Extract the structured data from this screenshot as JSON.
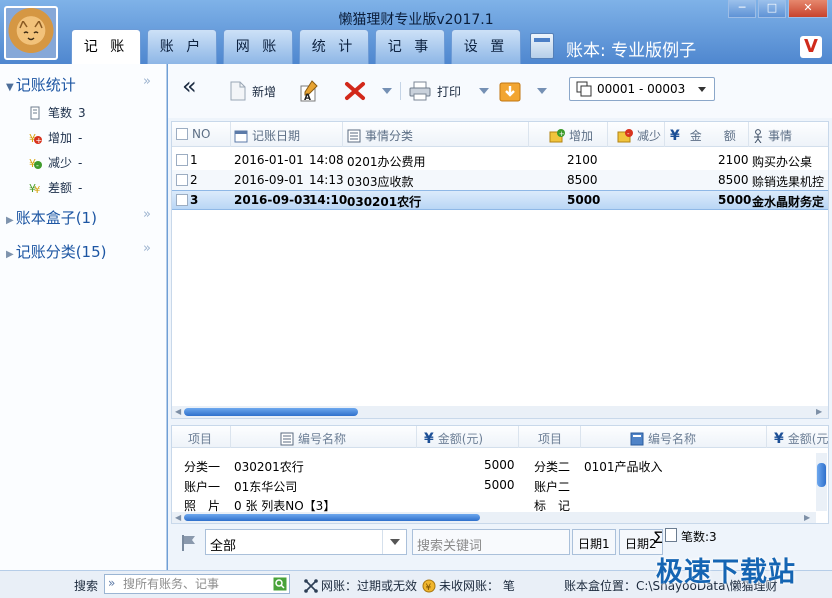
{
  "window": {
    "title": "懒猫理财专业版v2017.1",
    "controls": {
      "minimize": "─",
      "maximize": "□",
      "close": "✕"
    }
  },
  "tabs": [
    {
      "label": "记 账",
      "active": true
    },
    {
      "label": "账 户",
      "active": false
    },
    {
      "label": "网 账",
      "active": false
    },
    {
      "label": "统 计",
      "active": false
    },
    {
      "label": "记 事",
      "active": false
    },
    {
      "label": "设 置",
      "active": false
    }
  ],
  "book": {
    "label": "账本: 专业版例子",
    "logo": "V"
  },
  "sidebar": {
    "sections": [
      {
        "label": "记账统计",
        "expanded": true
      },
      {
        "label": "账本盒子(1)",
        "expanded": false
      },
      {
        "label": "记账分类(15)",
        "expanded": false
      }
    ],
    "collapse_glyph": "»",
    "stats": [
      {
        "icon": "ledger-icon",
        "label": "笔数",
        "value": "3"
      },
      {
        "icon": "increase-icon",
        "label": "增加",
        "value": "-"
      },
      {
        "icon": "decrease-icon",
        "label": "减少",
        "value": "-"
      },
      {
        "icon": "difference-icon",
        "label": "差额",
        "value": "-"
      }
    ]
  },
  "toolbar": {
    "back_glyph": "«",
    "new_label": "新增",
    "print_label": "打印",
    "range_value": "00001 - 00003"
  },
  "grid": {
    "columns": {
      "no": "NO",
      "date": "记账日期",
      "category": "事情分类",
      "increase": "增加",
      "decrease": "减少",
      "amount_a": "金",
      "amount_b": "额",
      "matter": "事情"
    },
    "rows": [
      {
        "no": "1",
        "date": "2016-01-01",
        "time": "14:08",
        "category": "0201办公费用",
        "increase": "2100",
        "amount": "2100",
        "matter": "购买办公桌",
        "selected": false
      },
      {
        "no": "2",
        "date": "2016-09-01",
        "time": "14:13",
        "category": "0303应收款",
        "increase": "8500",
        "amount": "8500",
        "matter": "赊销选果机控",
        "selected": false
      },
      {
        "no": "3",
        "date": "2016-09-03",
        "time": "14:10",
        "category": "030201农行",
        "increase": "5000",
        "amount": "5000",
        "matter": "金水晶财务定",
        "selected": true
      }
    ]
  },
  "detail": {
    "headers": {
      "item": "项目",
      "code_name": "编号名称",
      "amount": "金额(元)",
      "item2": "项目",
      "code_name2": "编号名称",
      "amount2": "金额(元"
    },
    "left": [
      {
        "label": "分类一",
        "value": "030201农行",
        "amount": "5000"
      },
      {
        "label": "账户一",
        "value": "01东华公司",
        "amount": "5000"
      },
      {
        "label": "照　片",
        "value": "0  张    列表NO【3】",
        "amount": ""
      }
    ],
    "right": [
      {
        "label": "分类二",
        "value": "0101产品收入"
      },
      {
        "label": "账户二",
        "value": ""
      },
      {
        "label": "标　记",
        "value": ""
      }
    ]
  },
  "filter": {
    "scope": "全部",
    "keyword_placeholder": "搜索关键词",
    "date1": "日期1",
    "date2": "日期2",
    "count_label": "笔数:3"
  },
  "status": {
    "search_label": "搜索",
    "search_placeholder": "搜所有账务、记事",
    "netbook_text": "网账：过期或无效",
    "unreceived_text": "未收网账：  笔",
    "location_text": "账本盒位置：C:\\ShayooData\\懒猫理财"
  },
  "watermark": "极速下载站"
}
